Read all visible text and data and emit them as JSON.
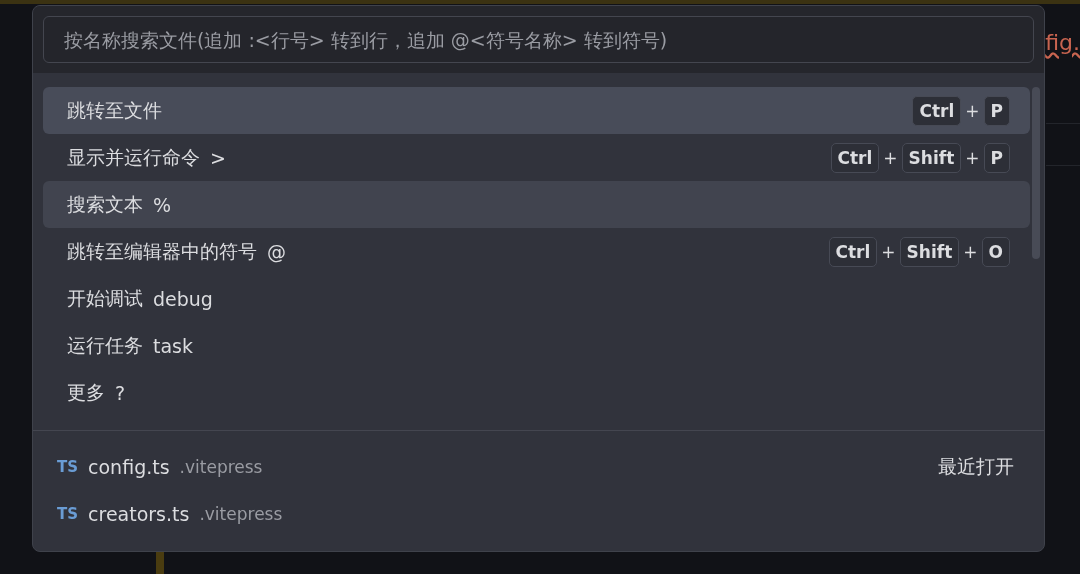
{
  "editor": {
    "tab_fragment": "fig."
  },
  "palette": {
    "search": {
      "placeholder": "按名称搜索文件(追加 :<行号> 转到行，追加 @<符号名称> 转到符号)"
    },
    "commands": [
      {
        "label": "跳转至文件",
        "keys": [
          {
            "kind": "key",
            "text": "Ctrl"
          },
          {
            "kind": "plus",
            "text": "+"
          },
          {
            "kind": "key",
            "text": "P"
          }
        ],
        "selected": true,
        "hovered": false
      },
      {
        "label": "显示并运行命令",
        "hint": ">",
        "keys": [
          {
            "kind": "key",
            "text": "Ctrl"
          },
          {
            "kind": "plus",
            "text": "+"
          },
          {
            "kind": "key",
            "text": "Shift"
          },
          {
            "kind": "plus",
            "text": "+"
          },
          {
            "kind": "key",
            "text": "P"
          }
        ],
        "selected": false,
        "hovered": false
      },
      {
        "label": "搜索文本",
        "hint": "%",
        "selected": false,
        "hovered": true
      },
      {
        "label": "跳转至编辑器中的符号",
        "hint": "@",
        "keys": [
          {
            "kind": "key",
            "text": "Ctrl"
          },
          {
            "kind": "plus",
            "text": "+"
          },
          {
            "kind": "key",
            "text": "Shift"
          },
          {
            "kind": "plus",
            "text": "+"
          },
          {
            "kind": "key",
            "text": "O"
          }
        ],
        "selected": false,
        "hovered": false
      },
      {
        "label": "开始调试",
        "hint": "debug",
        "selected": false,
        "hovered": false
      },
      {
        "label": "运行任务",
        "hint": "task",
        "selected": false,
        "hovered": false
      },
      {
        "label": "更多",
        "hint": "?",
        "selected": false,
        "hovered": false
      }
    ],
    "recent_label": "最近打开",
    "files": [
      {
        "icon": "TS",
        "name": "config.ts",
        "folder": ".vitepress"
      },
      {
        "icon": "TS",
        "name": "creators.ts",
        "folder": ".vitepress"
      }
    ]
  }
}
